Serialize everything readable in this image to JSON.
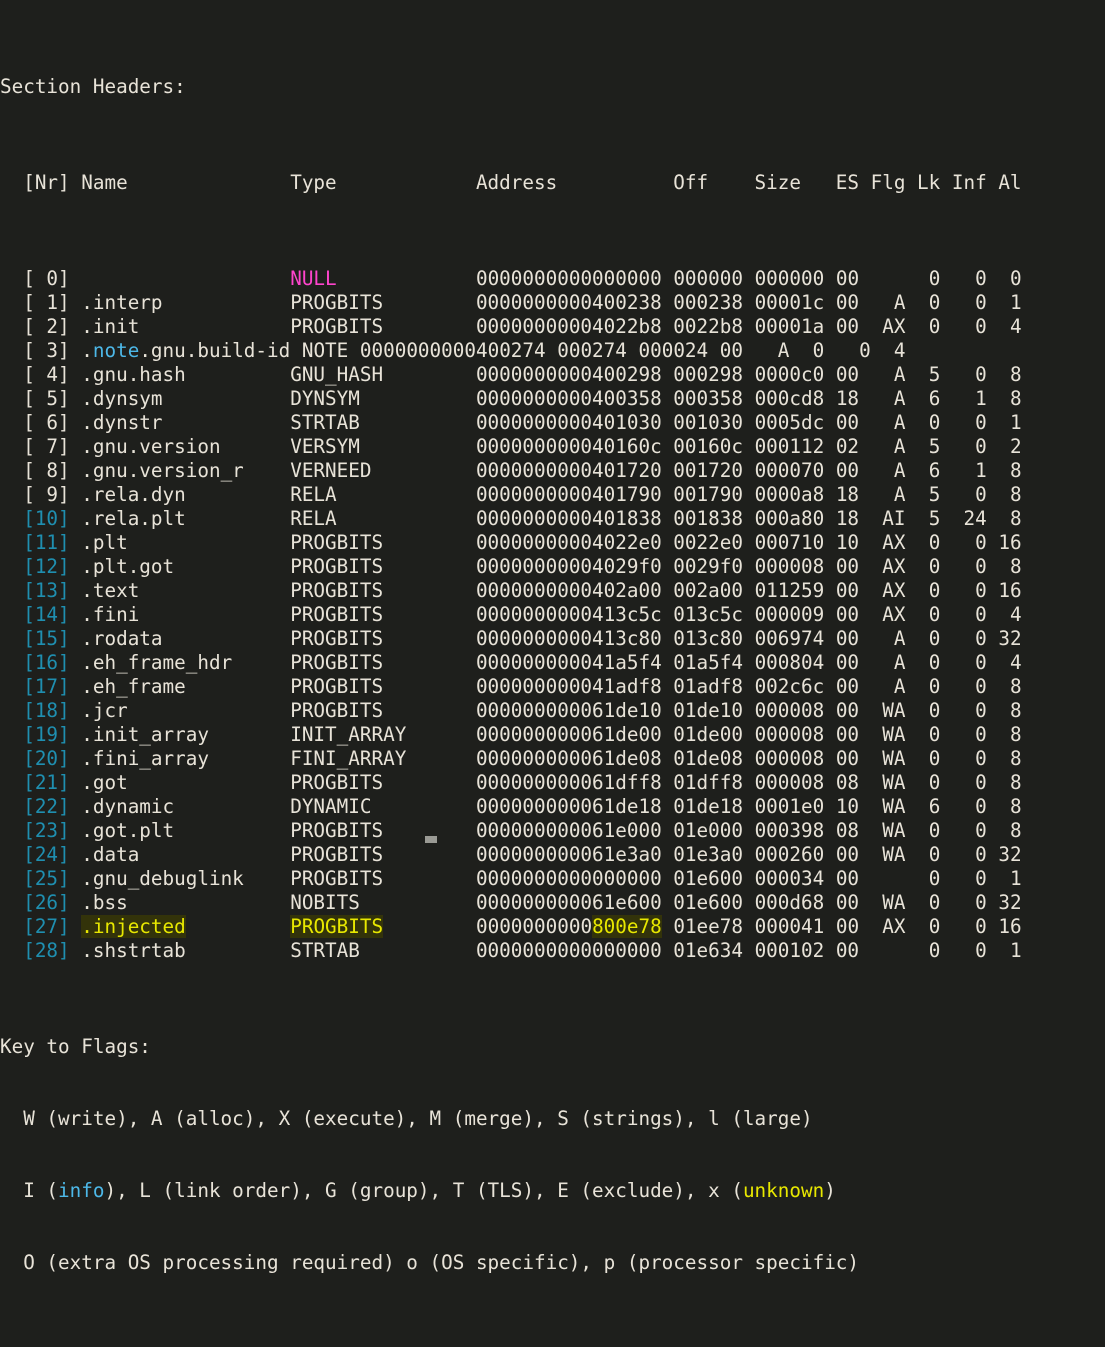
{
  "terminal": {
    "title": "Section Headers:",
    "background": "#1e1f1c",
    "foreground": "#e8e3d8",
    "colors": {
      "index_cyan": "#1f8fb0",
      "name_cyan": "#4db8e8",
      "null_magenta": "#ff44cc",
      "injected_yellow": "#e8e800",
      "highlight_bg": "#33330a"
    }
  },
  "table": {
    "headers": {
      "nr": "[Nr]",
      "name": "Name",
      "type": "Type",
      "address": "Address",
      "off": "Off",
      "size": "Size",
      "es": "ES",
      "flg": "Flg",
      "lk": "Lk",
      "inf": "Inf",
      "al": "Al"
    },
    "header_line": "  [Nr] Name              Type            Address          Off    Size   ES Flg Lk Inf Al",
    "rows": [
      {
        "nr": "[ 0]",
        "name": "",
        "type": "NULL",
        "address": "0000000000000000",
        "off": "000000",
        "size": "000000",
        "es": "00",
        "flg": "",
        "lk": "0",
        "inf": "0",
        "al": "0"
      },
      {
        "nr": "[ 1]",
        "name": ".interp",
        "type": "PROGBITS",
        "address": "0000000000400238",
        "off": "000238",
        "size": "00001c",
        "es": "00",
        "flg": "A",
        "lk": "0",
        "inf": "0",
        "al": "1"
      },
      {
        "nr": "[ 2]",
        "name": ".init",
        "type": "PROGBITS",
        "address": "00000000004022b8",
        "off": "0022b8",
        "size": "00001a",
        "es": "00",
        "flg": "AX",
        "lk": "0",
        "inf": "0",
        "al": "4"
      },
      {
        "nr": "[ 3]",
        "name": ".note.gnu.build-id",
        "type": "NOTE",
        "address": "0000000000400274",
        "off": "000274",
        "size": "000024",
        "es": "00",
        "flg": "A",
        "lk": "0",
        "inf": "0",
        "al": "4"
      },
      {
        "nr": "[ 4]",
        "name": ".gnu.hash",
        "type": "GNU_HASH",
        "address": "0000000000400298",
        "off": "000298",
        "size": "0000c0",
        "es": "00",
        "flg": "A",
        "lk": "5",
        "inf": "0",
        "al": "8"
      },
      {
        "nr": "[ 5]",
        "name": ".dynsym",
        "type": "DYNSYM",
        "address": "0000000000400358",
        "off": "000358",
        "size": "000cd8",
        "es": "18",
        "flg": "A",
        "lk": "6",
        "inf": "1",
        "al": "8"
      },
      {
        "nr": "[ 6]",
        "name": ".dynstr",
        "type": "STRTAB",
        "address": "0000000000401030",
        "off": "001030",
        "size": "0005dc",
        "es": "00",
        "flg": "A",
        "lk": "0",
        "inf": "0",
        "al": "1"
      },
      {
        "nr": "[ 7]",
        "name": ".gnu.version",
        "type": "VERSYM",
        "address": "000000000040160c",
        "off": "00160c",
        "size": "000112",
        "es": "02",
        "flg": "A",
        "lk": "5",
        "inf": "0",
        "al": "2"
      },
      {
        "nr": "[ 8]",
        "name": ".gnu.version_r",
        "type": "VERNEED",
        "address": "0000000000401720",
        "off": "001720",
        "size": "000070",
        "es": "00",
        "flg": "A",
        "lk": "6",
        "inf": "1",
        "al": "8"
      },
      {
        "nr": "[ 9]",
        "name": ".rela.dyn",
        "type": "RELA",
        "address": "0000000000401790",
        "off": "001790",
        "size": "0000a8",
        "es": "18",
        "flg": "A",
        "lk": "5",
        "inf": "0",
        "al": "8"
      },
      {
        "nr": "[10]",
        "name": ".rela.plt",
        "type": "RELA",
        "address": "0000000000401838",
        "off": "001838",
        "size": "000a80",
        "es": "18",
        "flg": "AI",
        "lk": "5",
        "inf": "24",
        "al": "8"
      },
      {
        "nr": "[11]",
        "name": ".plt",
        "type": "PROGBITS",
        "address": "00000000004022e0",
        "off": "0022e0",
        "size": "000710",
        "es": "10",
        "flg": "AX",
        "lk": "0",
        "inf": "0",
        "al": "16"
      },
      {
        "nr": "[12]",
        "name": ".plt.got",
        "type": "PROGBITS",
        "address": "00000000004029f0",
        "off": "0029f0",
        "size": "000008",
        "es": "00",
        "flg": "AX",
        "lk": "0",
        "inf": "0",
        "al": "8"
      },
      {
        "nr": "[13]",
        "name": ".text",
        "type": "PROGBITS",
        "address": "0000000000402a00",
        "off": "002a00",
        "size": "011259",
        "es": "00",
        "flg": "AX",
        "lk": "0",
        "inf": "0",
        "al": "16"
      },
      {
        "nr": "[14]",
        "name": ".fini",
        "type": "PROGBITS",
        "address": "0000000000413c5c",
        "off": "013c5c",
        "size": "000009",
        "es": "00",
        "flg": "AX",
        "lk": "0",
        "inf": "0",
        "al": "4"
      },
      {
        "nr": "[15]",
        "name": ".rodata",
        "type": "PROGBITS",
        "address": "0000000000413c80",
        "off": "013c80",
        "size": "006974",
        "es": "00",
        "flg": "A",
        "lk": "0",
        "inf": "0",
        "al": "32"
      },
      {
        "nr": "[16]",
        "name": ".eh_frame_hdr",
        "type": "PROGBITS",
        "address": "000000000041a5f4",
        "off": "01a5f4",
        "size": "000804",
        "es": "00",
        "flg": "A",
        "lk": "0",
        "inf": "0",
        "al": "4"
      },
      {
        "nr": "[17]",
        "name": ".eh_frame",
        "type": "PROGBITS",
        "address": "000000000041adf8",
        "off": "01adf8",
        "size": "002c6c",
        "es": "00",
        "flg": "A",
        "lk": "0",
        "inf": "0",
        "al": "8"
      },
      {
        "nr": "[18]",
        "name": ".jcr",
        "type": "PROGBITS",
        "address": "000000000061de10",
        "off": "01de10",
        "size": "000008",
        "es": "00",
        "flg": "WA",
        "lk": "0",
        "inf": "0",
        "al": "8"
      },
      {
        "nr": "[19]",
        "name": ".init_array",
        "type": "INIT_ARRAY",
        "address": "000000000061de00",
        "off": "01de00",
        "size": "000008",
        "es": "00",
        "flg": "WA",
        "lk": "0",
        "inf": "0",
        "al": "8"
      },
      {
        "nr": "[20]",
        "name": ".fini_array",
        "type": "FINI_ARRAY",
        "address": "000000000061de08",
        "off": "01de08",
        "size": "000008",
        "es": "00",
        "flg": "WA",
        "lk": "0",
        "inf": "0",
        "al": "8"
      },
      {
        "nr": "[21]",
        "name": ".got",
        "type": "PROGBITS",
        "address": "000000000061dff8",
        "off": "01dff8",
        "size": "000008",
        "es": "08",
        "flg": "WA",
        "lk": "0",
        "inf": "0",
        "al": "8"
      },
      {
        "nr": "[22]",
        "name": ".dynamic",
        "type": "DYNAMIC",
        "address": "000000000061de18",
        "off": "01de18",
        "size": "0001e0",
        "es": "10",
        "flg": "WA",
        "lk": "6",
        "inf": "0",
        "al": "8"
      },
      {
        "nr": "[23]",
        "name": ".got.plt",
        "type": "PROGBITS",
        "address": "000000000061e000",
        "off": "01e000",
        "size": "000398",
        "es": "08",
        "flg": "WA",
        "lk": "0",
        "inf": "0",
        "al": "8"
      },
      {
        "nr": "[24]",
        "name": ".data",
        "type": "PROGBITS",
        "address": "000000000061e3a0",
        "off": "01e3a0",
        "size": "000260",
        "es": "00",
        "flg": "WA",
        "lk": "0",
        "inf": "0",
        "al": "32"
      },
      {
        "nr": "[25]",
        "name": ".gnu_debuglink",
        "type": "PROGBITS",
        "address": "0000000000000000",
        "off": "01e600",
        "size": "000034",
        "es": "00",
        "flg": "",
        "lk": "0",
        "inf": "0",
        "al": "1"
      },
      {
        "nr": "[26]",
        "name": ".bss",
        "type": "NOBITS",
        "address": "000000000061e600",
        "off": "01e600",
        "size": "000d68",
        "es": "00",
        "flg": "WA",
        "lk": "0",
        "inf": "0",
        "al": "32"
      },
      {
        "nr": "[27]",
        "name": ".injected",
        "type": "PROGBITS",
        "address": "0000000000800e78",
        "off": "01ee78",
        "size": "000041",
        "es": "00",
        "flg": "AX",
        "lk": "0",
        "inf": "0",
        "al": "16"
      },
      {
        "nr": "[28]",
        "name": ".shstrtab",
        "type": "STRTAB",
        "address": "0000000000000000",
        "off": "01e634",
        "size": "000102",
        "es": "00",
        "flg": "",
        "lk": "0",
        "inf": "0",
        "al": "1"
      }
    ]
  },
  "key_to_flags": {
    "title": "Key to Flags:",
    "line1": "  W (write), A (alloc), X (execute), M (merge), S (strings), l (large)",
    "line2_a": "  I (",
    "line2_info": "info",
    "line2_b": "), L (link order), G (group), T (TLS), E (exclude), x (",
    "line2_unknown": "unknown",
    "line2_c": ")",
    "line3": "  O (extra OS processing required) o (OS specific), p (processor specific)"
  }
}
